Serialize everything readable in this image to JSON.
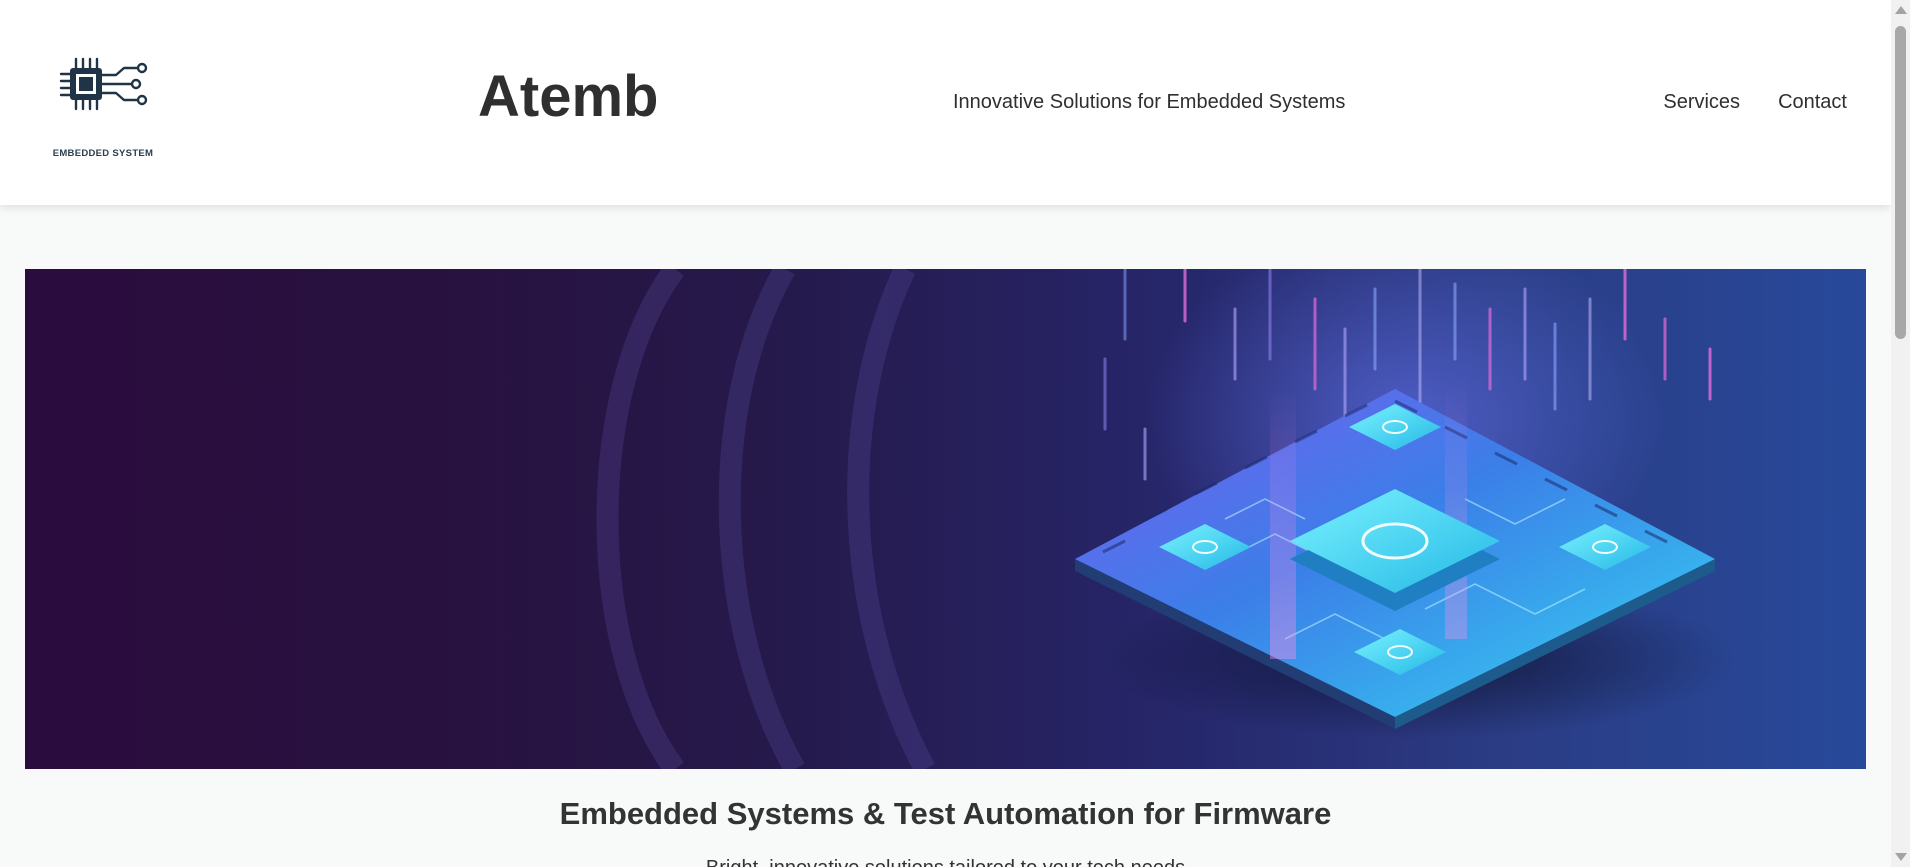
{
  "header": {
    "logo_caption": "EMBEDDED SYSTEM",
    "brand": "Atemb",
    "tagline": "Innovative Solutions for Embedded Systems",
    "nav": [
      {
        "label": "Services"
      },
      {
        "label": "Contact"
      }
    ]
  },
  "hero": {
    "title": "Embedded Systems & Test Automation for Firmware",
    "subtitle": "Bright, innovative solutions tailored to your tech needs"
  },
  "icons": {
    "logo": "microchip-circuit-icon",
    "hero": "isometric-circuit-board-illustration"
  },
  "colors": {
    "text": "#333333",
    "logo": "#1f3446",
    "hero_dark": "#2a0c3e",
    "hero_light": "#27499a",
    "chip_cyan": "#35d6f2",
    "accent_pink": "#e85ad6"
  }
}
